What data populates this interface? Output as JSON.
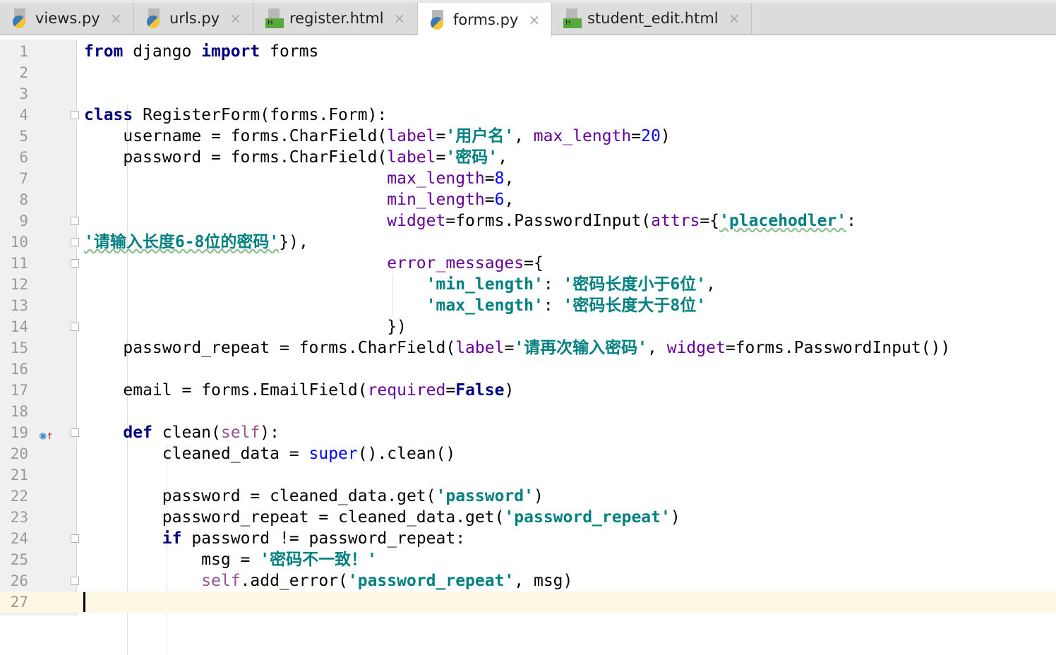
{
  "tabs": [
    {
      "label": "views.py",
      "icon": "python-file-icon",
      "active": false
    },
    {
      "label": "urls.py",
      "icon": "python-file-icon",
      "active": false
    },
    {
      "label": "register.html",
      "icon": "html-file-icon",
      "active": false
    },
    {
      "label": "forms.py",
      "icon": "python-file-icon",
      "active": true
    },
    {
      "label": "student_edit.html",
      "icon": "html-file-icon",
      "active": false
    }
  ],
  "close_glyph": "×",
  "current_line": 27,
  "lines": [
    [
      [
        "kw",
        "from"
      ],
      [
        "t",
        " django "
      ],
      [
        "kw",
        "import"
      ],
      [
        "t",
        " forms"
      ]
    ],
    [],
    [],
    [
      [
        "kw",
        "class"
      ],
      [
        "t",
        " RegisterForm(forms.Form):"
      ]
    ],
    [
      [
        "t",
        "    username = forms.CharField("
      ],
      [
        "kwarg",
        "label"
      ],
      [
        "t",
        "="
      ],
      [
        "str",
        "'用户名'"
      ],
      [
        "t",
        ", "
      ],
      [
        "kwarg",
        "max_length"
      ],
      [
        "t",
        "="
      ],
      [
        "num",
        "20"
      ],
      [
        "t",
        ")"
      ]
    ],
    [
      [
        "t",
        "    password = forms.CharField("
      ],
      [
        "kwarg",
        "label"
      ],
      [
        "t",
        "="
      ],
      [
        "str",
        "'密码'"
      ],
      [
        "t",
        ","
      ]
    ],
    [
      [
        "t",
        "                               "
      ],
      [
        "kwarg",
        "max_length"
      ],
      [
        "t",
        "="
      ],
      [
        "num",
        "8"
      ],
      [
        "t",
        ","
      ]
    ],
    [
      [
        "t",
        "                               "
      ],
      [
        "kwarg",
        "min_length"
      ],
      [
        "t",
        "="
      ],
      [
        "num",
        "6"
      ],
      [
        "t",
        ","
      ]
    ],
    [
      [
        "t",
        "                               "
      ],
      [
        "kwarg",
        "widget"
      ],
      [
        "t",
        "=forms.PasswordInput("
      ],
      [
        "kwarg",
        "attrs"
      ],
      [
        "t",
        "={"
      ],
      [
        "strw",
        "'placehodler'"
      ],
      [
        "t",
        ":"
      ]
    ],
    [
      [
        "strw",
        "'请输入长度6-8位的密码'"
      ],
      [
        "t",
        "}),"
      ]
    ],
    [
      [
        "t",
        "                               "
      ],
      [
        "kwarg",
        "error_messages"
      ],
      [
        "t",
        "={"
      ]
    ],
    [
      [
        "t",
        "                                   "
      ],
      [
        "str",
        "'min_length'"
      ],
      [
        "t",
        ": "
      ],
      [
        "str",
        "'密码长度小于6位'"
      ],
      [
        "t",
        ","
      ]
    ],
    [
      [
        "t",
        "                                   "
      ],
      [
        "str",
        "'max_length'"
      ],
      [
        "t",
        ": "
      ],
      [
        "str",
        "'密码长度大于8位'"
      ]
    ],
    [
      [
        "t",
        "                               })"
      ]
    ],
    [
      [
        "t",
        "    password_repeat = forms.CharField("
      ],
      [
        "kwarg",
        "label"
      ],
      [
        "t",
        "="
      ],
      [
        "str",
        "'请再次输入密码'"
      ],
      [
        "t",
        ", "
      ],
      [
        "kwarg",
        "widget"
      ],
      [
        "t",
        "=forms.PasswordInput())"
      ]
    ],
    [],
    [
      [
        "t",
        "    email = forms.EmailField("
      ],
      [
        "kwarg",
        "required"
      ],
      [
        "t",
        "="
      ],
      [
        "kw",
        "False"
      ],
      [
        "t",
        ")"
      ]
    ],
    [],
    [
      [
        "t",
        "    "
      ],
      [
        "kw",
        "def"
      ],
      [
        "t",
        " clean("
      ],
      [
        "self",
        "self"
      ],
      [
        "t",
        "):"
      ]
    ],
    [
      [
        "t",
        "        cleaned_data = "
      ],
      [
        "num",
        "super"
      ],
      [
        "t",
        "().clean()"
      ]
    ],
    [],
    [
      [
        "t",
        "        password = cleaned_data.get("
      ],
      [
        "str",
        "'password'"
      ],
      [
        "t",
        ")"
      ]
    ],
    [
      [
        "t",
        "        password_repeat = cleaned_data.get("
      ],
      [
        "str",
        "'password_repeat'"
      ],
      [
        "t",
        ")"
      ]
    ],
    [
      [
        "t",
        "        "
      ],
      [
        "kw",
        "if"
      ],
      [
        "t",
        " password != password_repeat:"
      ]
    ],
    [
      [
        "t",
        "            msg = "
      ],
      [
        "str",
        "'密码不一致！'"
      ]
    ],
    [
      [
        "t",
        "            "
      ],
      [
        "self",
        "self"
      ],
      [
        "t",
        ".add_error("
      ],
      [
        "str",
        "'password_repeat'"
      ],
      [
        "t",
        ", msg)"
      ]
    ],
    []
  ],
  "folds": [
    4,
    9,
    10,
    11,
    14,
    19,
    24,
    26
  ],
  "override_marker_line": 19,
  "colors": {
    "keyword": "#000080",
    "string": "#008080",
    "kwarg": "#660099",
    "number": "#0000ff",
    "self": "#94558d",
    "current_line": "#fdf8e3"
  }
}
